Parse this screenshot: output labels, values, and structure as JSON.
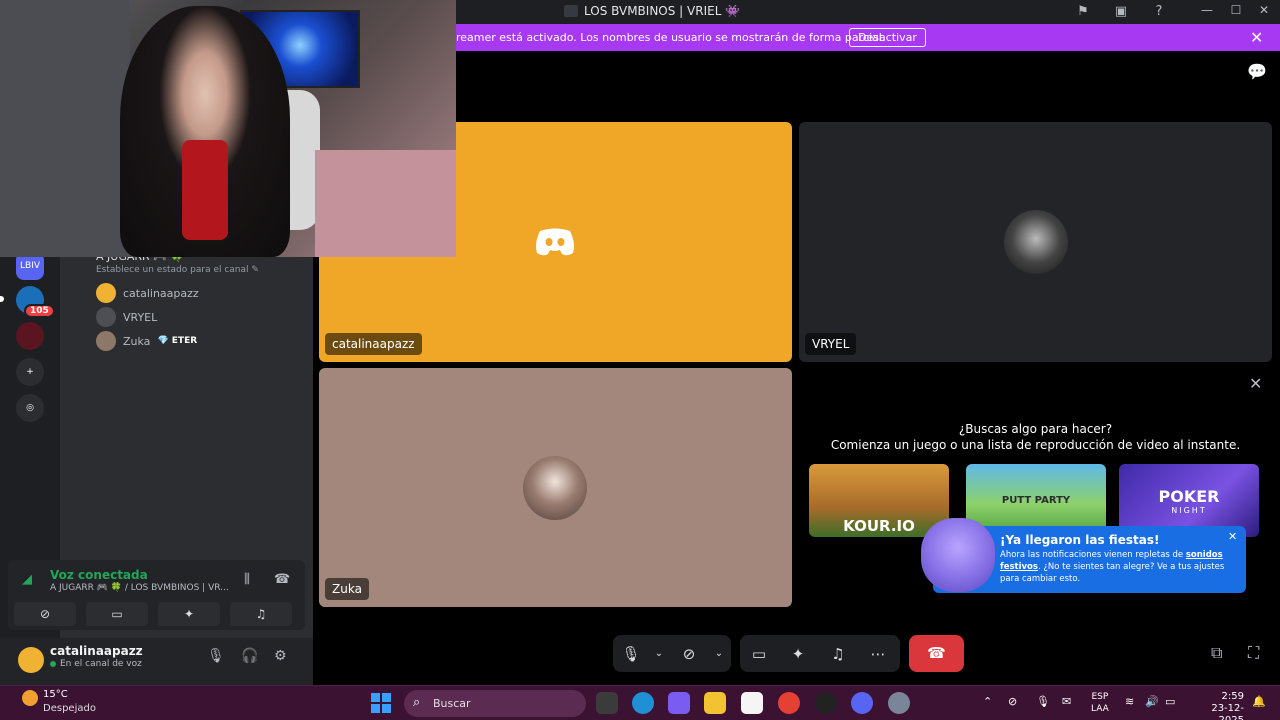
{
  "window": {
    "title": "LOS BVMBINOS | VRIEL 👾"
  },
  "banner": {
    "text": "reamer está activado. Los nombres de usuario se mostrarán de forma parcial.",
    "button": "Desactivar"
  },
  "sidebar": {
    "guilds": [
      {
        "label": "LBIV",
        "icon": "server-lbiv-icon"
      },
      {
        "label": "",
        "icon": "server-dolphin-icon",
        "badge": "105"
      },
      {
        "label": "",
        "icon": "server-courage-icon"
      },
      {
        "label": "+",
        "icon": "add-server-icon"
      },
      {
        "label": "◎",
        "icon": "discover-icon"
      }
    ],
    "voice_channel": {
      "name": "A JUGARR 🎮 🍀",
      "status": "Establece un estado para el canal ✎",
      "members": [
        {
          "name": "catalinaapazz",
          "badge": ""
        },
        {
          "name": "VRYEL",
          "badge": ""
        },
        {
          "name": "Zuka",
          "badge": "💎 ETER"
        }
      ]
    },
    "voice_panel": {
      "status": "Voz conectada",
      "channel": "A JUGARR 🎮 🍀 / LOS BVMBINOS | VR..."
    },
    "user": {
      "name": "catalinaapazz",
      "status": "En el canal de voz"
    }
  },
  "call": {
    "tiles": [
      {
        "name": "catalinaapazz",
        "bg": "#f0a626"
      },
      {
        "name": "VRYEL",
        "bg": "#232428"
      },
      {
        "name": "Zuka",
        "bg": "#a3877c"
      }
    ],
    "promo": {
      "line1": "¿Buscas algo para hacer?",
      "line2": "Comienza un juego o una lista de reproducción de video al instante.",
      "games": [
        {
          "name": "KOUR.IO"
        },
        {
          "name": "PUTT PARTY"
        },
        {
          "name": "POKER",
          "sub": "NIGHT"
        }
      ]
    },
    "tooltip": {
      "title": "¡Ya llegaron las fiestas!",
      "body_pre": "Ahora las notificaciones vienen repletas de ",
      "body_link": "sonidos festivos",
      "body_post": ". ¿No te sientes tan alegre? Ve a tus ajustes para cambiar esto."
    }
  },
  "taskbar": {
    "weather_temp": "15°C",
    "weather_desc": "Despejado",
    "search_placeholder": "Buscar",
    "lang_1": "ESP",
    "lang_2": "LAA",
    "time": "2:59",
    "date": "23-12-2025"
  },
  "colors": {
    "accent": "#5865f2",
    "banner": "#a739f2",
    "hangup": "#da373c",
    "connected": "#23a55a"
  }
}
